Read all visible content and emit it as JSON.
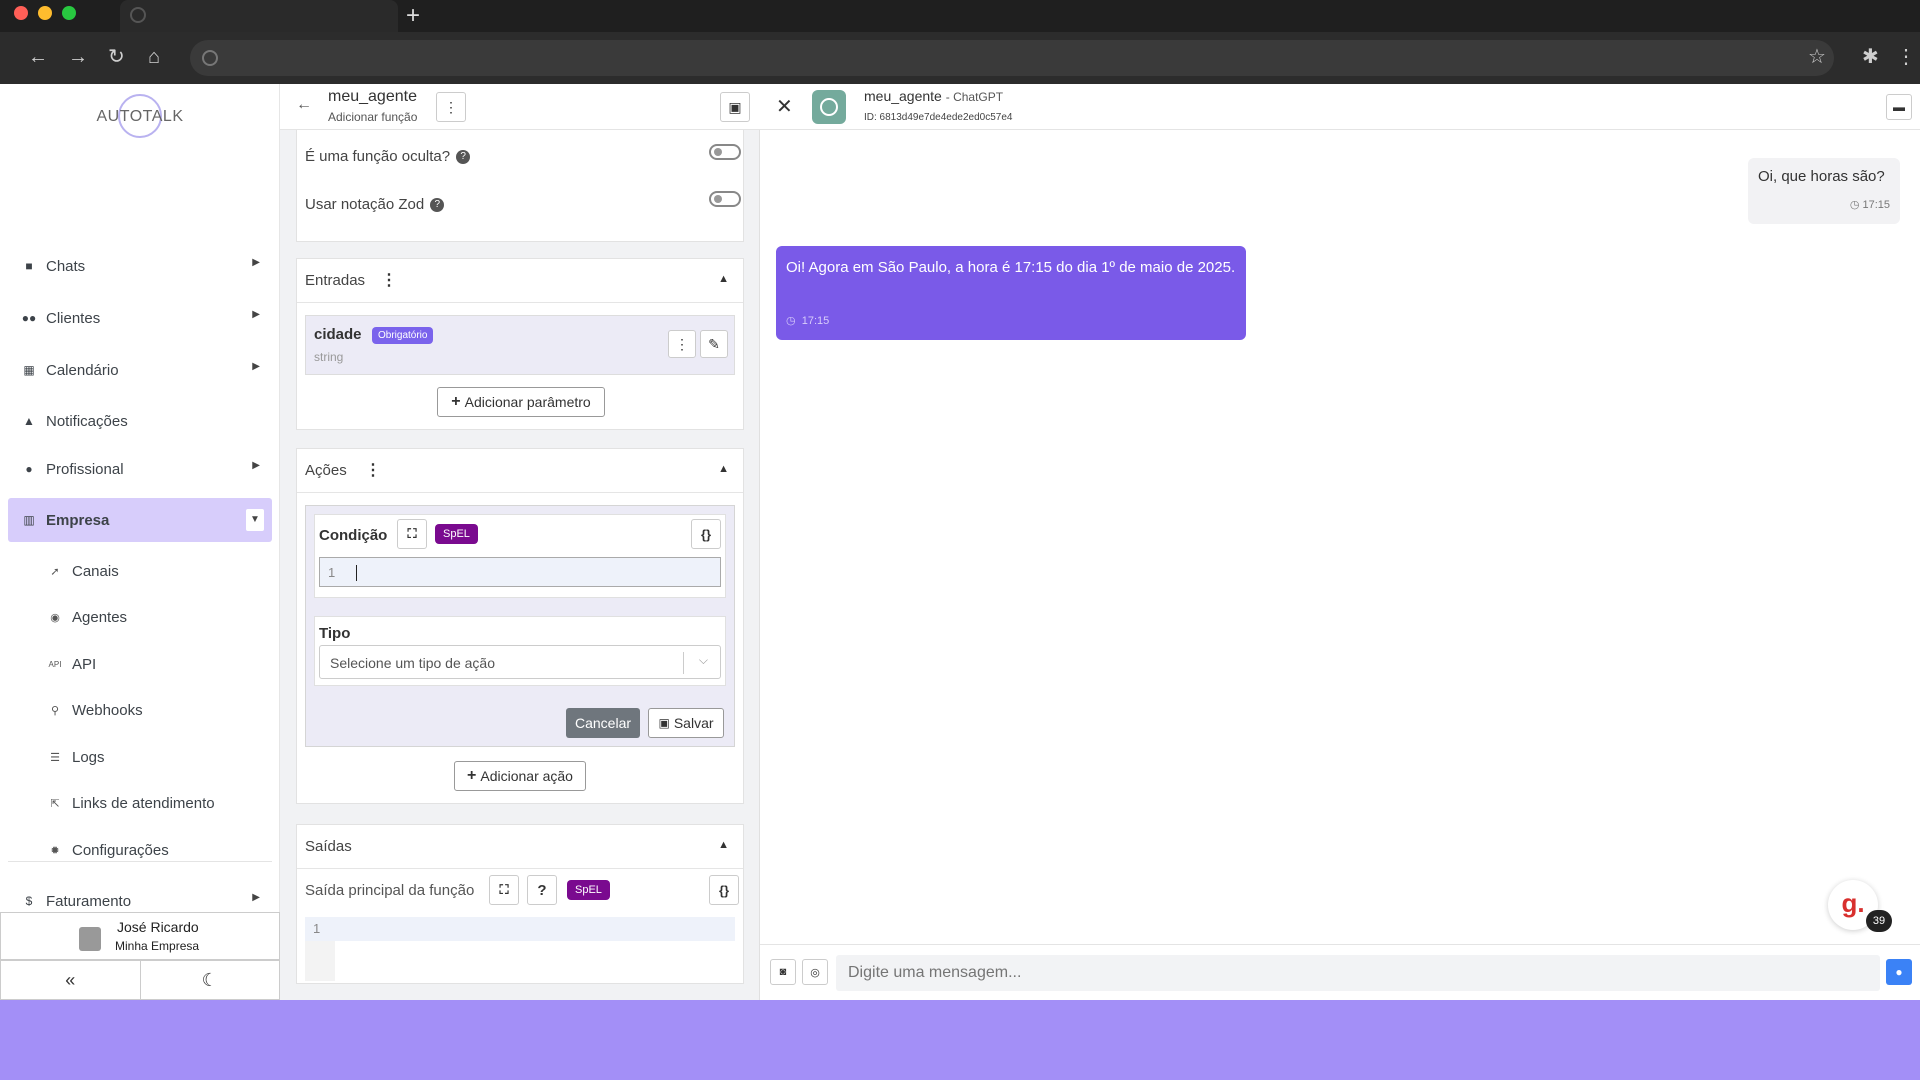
{
  "sidebar": {
    "logo": "AUTOTALK",
    "items": [
      {
        "label": "Chats",
        "icon": "chat-icon"
      },
      {
        "label": "Clientes",
        "icon": "users-icon"
      },
      {
        "label": "Calendário",
        "icon": "calendar-icon"
      },
      {
        "label": "Notificações",
        "icon": "bell-icon"
      },
      {
        "label": "Profissional",
        "icon": "user-cog-icon"
      },
      {
        "label": "Empresa",
        "icon": "building-icon"
      }
    ],
    "sub_items": [
      {
        "label": "Canais",
        "icon": "rocket-icon"
      },
      {
        "label": "Agentes",
        "icon": "robot-icon"
      },
      {
        "label": "API",
        "icon": "api-icon"
      },
      {
        "label": "Webhooks",
        "icon": "webhook-icon"
      },
      {
        "label": "Logs",
        "icon": "list-icon"
      },
      {
        "label": "Links de atendimento",
        "icon": "external-link-icon"
      },
      {
        "label": "Configurações",
        "icon": "gear-icon"
      }
    ],
    "billing": {
      "label": "Faturamento",
      "icon": "dollar-icon"
    },
    "user": {
      "name": "José Ricardo",
      "company": "Minha Empresa"
    }
  },
  "editor": {
    "title": "meu_agente",
    "subtitle": "Adicionar função",
    "hidden_function_label": "É uma função oculta?",
    "zod_label": "Usar notação Zod",
    "inputs": {
      "title": "Entradas",
      "param_name": "cidade",
      "param_badge": "Obrigatório",
      "param_type": "string",
      "add_param_label": "Adicionar parâmetro"
    },
    "actions": {
      "title": "Ações",
      "condition_label": "Condição",
      "spel_label": "SpEL",
      "line_number": "1",
      "type_label": "Tipo",
      "type_placeholder": "Selecione um tipo de ação",
      "cancel_label": "Cancelar",
      "save_label": "Salvar",
      "add_action_label": "Adicionar ação"
    },
    "outputs": {
      "title": "Saídas",
      "main_output_label": "Saída principal da função",
      "spel_label": "SpEL",
      "line_number": "1"
    }
  },
  "chat": {
    "agent_name": "meu_agente",
    "model": "ChatGPT",
    "agent_id": "ID: 6813d49e7de4ede2ed0c57e4",
    "messages": [
      {
        "from": "user",
        "text": "Oi, que horas são?",
        "time": "17:15"
      },
      {
        "from": "agent",
        "text": "Oi! Agora em São Paulo, a hora é 17:15 do dia 1º de maio de 2025.",
        "time": "17:15"
      }
    ],
    "input_placeholder": "Digite uma mensagem...",
    "grammarly_count": "39"
  },
  "colors": {
    "accent": "#7a5ae8",
    "active_nav": "#d7cdfb",
    "spel_badge": "#7a0a8f",
    "desktop": "#a38ff7"
  }
}
